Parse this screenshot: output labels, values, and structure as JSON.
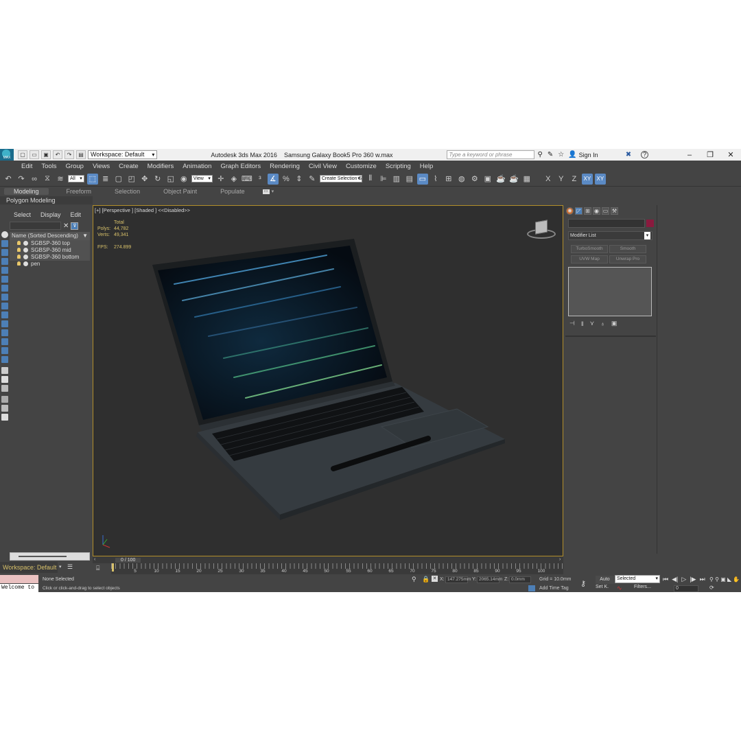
{
  "titlebar": {
    "app_logo": "MAX",
    "workspace_dropdown": "Workspace: Default",
    "app_title": "Autodesk 3ds Max 2016",
    "file_title": "Samsung Galaxy Book5 Pro 360 w.max",
    "search_placeholder": "Type a keyword or phrase",
    "sign_in": "Sign In"
  },
  "menu": [
    "Edit",
    "Tools",
    "Group",
    "Views",
    "Create",
    "Modifiers",
    "Animation",
    "Graph Editors",
    "Rendering",
    "Civil View",
    "Customize",
    "Scripting",
    "Help"
  ],
  "toolbar": {
    "filter_dropdown": "All",
    "ref_coord_dropdown": "View",
    "selection_set_dropdown": "Create Selection Se",
    "axis_buttons": [
      "X",
      "Y",
      "Z",
      "XY",
      "XY"
    ]
  },
  "ribbon": {
    "tabs": [
      "Modeling",
      "Freeform",
      "Selection",
      "Object Paint",
      "Populate"
    ],
    "active_tab": "Modeling",
    "sub_label": "Polygon Modeling"
  },
  "scene_explorer": {
    "tabs": [
      "Select",
      "Display",
      "Edit"
    ],
    "column_header": "Name (Sorted Descending)",
    "objects": [
      "SGBSP-360 top",
      "SGBSP-360 mid",
      "SGBSP-360 bottom",
      "pen"
    ]
  },
  "viewport": {
    "label": "[+] [Perspective ] [Shaded ]  <<Disabled>>",
    "stats": {
      "header": "Total",
      "polys_label": "Polys:",
      "polys_value": "44,782",
      "verts_label": "Verts:",
      "verts_value": "49,341",
      "fps_label": "FPS:",
      "fps_value": "274.899"
    }
  },
  "command_panel": {
    "modifier_list": "Modifier List",
    "buttons": [
      "TurboSmooth",
      "Smooth",
      "UVW Map",
      "Unwrap Pro"
    ],
    "object_color": "#8a1a3e"
  },
  "timeline": {
    "time_label": "0 / 100",
    "ticks": [
      "0",
      "5",
      "10",
      "15",
      "20",
      "25",
      "30",
      "35",
      "40",
      "45",
      "50",
      "55",
      "60",
      "65",
      "70",
      "75",
      "80",
      "85",
      "90",
      "95",
      "100"
    ]
  },
  "status": {
    "workspace": "Workspace: Default",
    "listener_text": "Welcome to",
    "selection": "None Selected",
    "prompt": "Click or click-and-drag to select objects",
    "x_label": "X:",
    "x_value": "147.275mm",
    "y_label": "Y:",
    "y_value": "2065.14mm",
    "z_label": "Z:",
    "z_value": "0.0mm",
    "grid": "Grid = 10.0mm",
    "add_time_tag": "Add Time Tag",
    "auto": "Auto",
    "set_key": "Set K.",
    "selected_dropdown": "Selected",
    "filters": "Filters...",
    "frame": "0"
  }
}
